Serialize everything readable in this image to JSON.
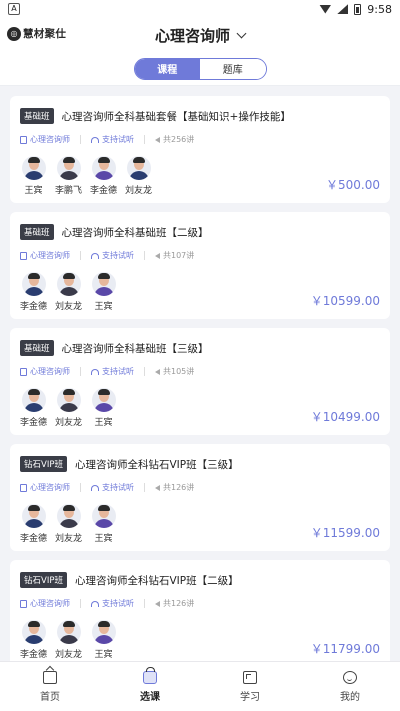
{
  "status": {
    "left_icon": "A",
    "time": "9:58"
  },
  "header": {
    "logo_text": "慧材聚仕",
    "title": "心理咨询师"
  },
  "tabs": [
    {
      "label": "课程",
      "active": true
    },
    {
      "label": "题库",
      "active": false
    }
  ],
  "courses": [
    {
      "badge": "基础班",
      "title": "心理咨询师全科基础套餐【基础知识+操作技能】",
      "category": "心理咨询师",
      "trial": "支持试听",
      "lessons": "共256讲",
      "teachers": [
        "王宾",
        "李鹏飞",
        "李金德",
        "刘友龙"
      ],
      "price": "￥500.00"
    },
    {
      "badge": "基础班",
      "title": "心理咨询师全科基础班【二级】",
      "category": "心理咨询师",
      "trial": "支持试听",
      "lessons": "共107讲",
      "teachers": [
        "李金德",
        "刘友龙",
        "王宾"
      ],
      "price": "￥10599.00"
    },
    {
      "badge": "基础班",
      "title": "心理咨询师全科基础班【三级】",
      "category": "心理咨询师",
      "trial": "支持试听",
      "lessons": "共105讲",
      "teachers": [
        "李金德",
        "刘友龙",
        "王宾"
      ],
      "price": "￥10499.00"
    },
    {
      "badge": "钻石VIP班",
      "title": "心理咨询师全科钻石VIP班【三级】",
      "category": "心理咨询师",
      "trial": "支持试听",
      "lessons": "共126讲",
      "teachers": [
        "李金德",
        "刘友龙",
        "王宾"
      ],
      "price": "￥11599.00"
    },
    {
      "badge": "钻石VIP班",
      "title": "心理咨询师全科钻石VIP班【二级】",
      "category": "心理咨询师",
      "trial": "支持试听",
      "lessons": "共126讲",
      "teachers": [
        "李金德",
        "刘友龙",
        "王宾"
      ],
      "price": "￥11799.00"
    }
  ],
  "bottom_nav": [
    {
      "label": "首页",
      "icon": "home-icon",
      "active": false
    },
    {
      "label": "选课",
      "icon": "course-basket-icon",
      "active": true
    },
    {
      "label": "学习",
      "icon": "study-icon",
      "active": false
    },
    {
      "label": "我的",
      "icon": "profile-icon",
      "active": false
    }
  ],
  "colors": {
    "accent": "#6f7ad9",
    "badge_bg": "#3a3d47",
    "page_bg": "#f2f3f7"
  }
}
